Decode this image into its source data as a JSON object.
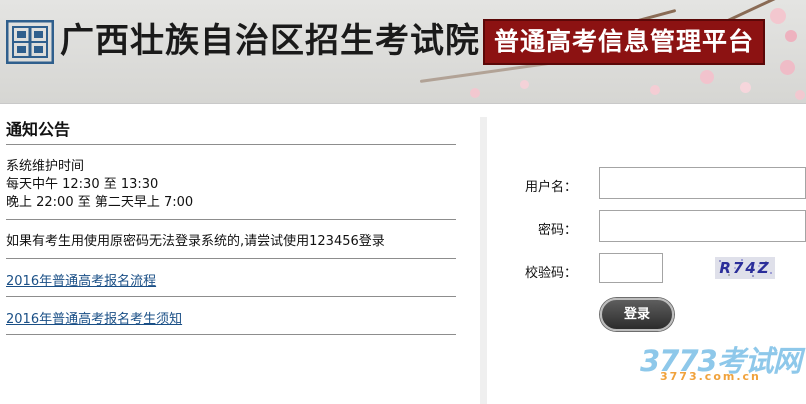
{
  "header": {
    "org_name": "广西壮族自治区招生考试院",
    "platform_title": "普通高考信息管理平台"
  },
  "notice": {
    "title": "通知公告",
    "maintenance": {
      "heading": "系统维护时间",
      "line1": "每天中午 12:30 至 13:30",
      "line2": "晚上 22:00 至 第二天早上 7:00"
    },
    "tip": "如果有考生用使用原密码无法登录系统的,请尝试使用123456登录",
    "links": [
      {
        "label": "2016年普通高考报名流程"
      },
      {
        "label": "2016年普通高考报名考生须知"
      }
    ]
  },
  "login": {
    "username_label": "用户名：",
    "username_value": "",
    "password_label": "密码：",
    "password_value": "",
    "captcha_label": "校验码：",
    "captcha_value": "",
    "captcha_image_text": "R74Z",
    "submit_label": "登录"
  },
  "watermark": {
    "big": "3773考试网",
    "small": "3773.com.cn"
  },
  "colors": {
    "platform_bg": "#8c1212",
    "link": "#1a4f86",
    "button": "#3a3a3a",
    "captcha_text": "#2b2e9a"
  }
}
